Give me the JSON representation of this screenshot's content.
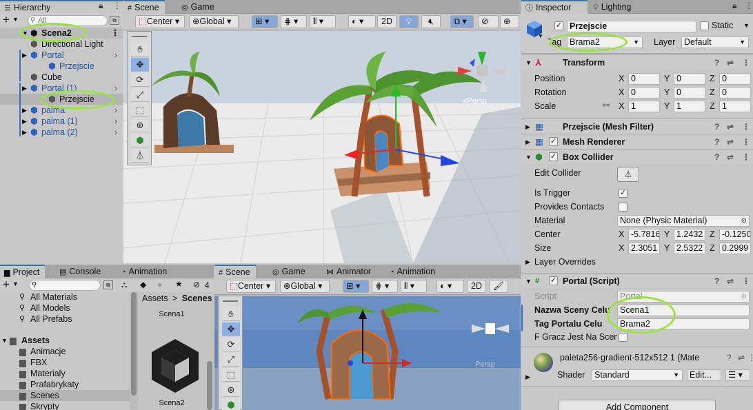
{
  "hierarchy": {
    "tab": "Hierarchy",
    "search_placeholder": "All",
    "scene": "Scena2",
    "items": [
      {
        "label": "Directional Light",
        "indent": 1,
        "kind": "obj"
      },
      {
        "label": "Portal",
        "indent": 1,
        "kind": "prefab"
      },
      {
        "label": "Przejscie",
        "indent": 2,
        "kind": "prefab-child"
      },
      {
        "label": "Cube",
        "indent": 1,
        "kind": "obj"
      },
      {
        "label": "Portal (1)",
        "indent": 1,
        "kind": "prefab"
      },
      {
        "label": "Przejscie",
        "indent": 2,
        "kind": "selected"
      },
      {
        "label": "palma",
        "indent": 1,
        "kind": "prefab"
      },
      {
        "label": "palma (1)",
        "indent": 1,
        "kind": "prefab"
      },
      {
        "label": "palma (2)",
        "indent": 1,
        "kind": "prefab"
      }
    ]
  },
  "top_view": {
    "tabs": {
      "scene": "Scene",
      "game": "Game"
    },
    "pivot": "Center",
    "space": "Global",
    "mode_2d": "2D",
    "gizmo_label": "<Persp"
  },
  "project": {
    "tabs": {
      "project": "Project",
      "console": "Console",
      "animation": "Animation"
    },
    "badge": "4",
    "favorites": [
      "All Materials",
      "All Models",
      "All Prefabs"
    ],
    "assets_root": "Assets",
    "folders": [
      "Animacje",
      "FBX",
      "Materialy",
      "Prafabrykaty",
      "Scenes",
      "Skrypty"
    ],
    "breadcrumb": {
      "root": "Assets",
      "sep": ">",
      "current": "Scenes"
    },
    "files": [
      "Scena1",
      "Scena2"
    ]
  },
  "bottom_view": {
    "tabs": {
      "scene": "Scene",
      "game": "Game",
      "animator": "Animator",
      "animation": "Animation"
    },
    "pivot": "Center",
    "space": "Global",
    "mode_2d": "2D",
    "gizmo_label": "Persp"
  },
  "inspector": {
    "tabs": {
      "inspector": "Inspector",
      "lighting": "Lighting"
    },
    "object_name": "Przejscie",
    "static_label": "Static",
    "tag_label": "Tag",
    "tag_value": "Brama2",
    "layer_label": "Layer",
    "layer_value": "Default",
    "transform": {
      "title": "Transform",
      "position": {
        "label": "Position",
        "x": "0",
        "y": "0",
        "z": "0"
      },
      "rotation": {
        "label": "Rotation",
        "x": "0",
        "y": "0",
        "z": "0"
      },
      "scale": {
        "label": "Scale",
        "x": "1",
        "y": "1",
        "z": "1"
      }
    },
    "mesh_filter": "Przejscie (Mesh Filter)",
    "mesh_renderer": "Mesh Renderer",
    "box_collider": {
      "title": "Box Collider",
      "edit_collider": "Edit Collider",
      "is_trigger": "Is Trigger",
      "provides_contacts": "Provides Contacts",
      "material_label": "Material",
      "material_value": "None (Physic Material)",
      "center": {
        "label": "Center",
        "x": "-5.7816",
        "y": "1.2432",
        "z": "-0.1250"
      },
      "size": {
        "label": "Size",
        "x": "2.3051",
        "y": "2.5322",
        "z": "0.2999"
      },
      "layer_overrides": "Layer Overrides"
    },
    "portal_script": {
      "title": "Portal (Script)",
      "script_label": "Script",
      "script_value": "Portal",
      "nazwa_label": "Nazwa Sceny Celu",
      "nazwa_value": "Scena1",
      "tag_label": "Tag Portalu Celu",
      "tag_value": "Brama2",
      "gracz_label": "F Gracz Jest Na Scen"
    },
    "material": {
      "name": "paleta256-gradient-512x512 1 (Mate",
      "shader_label": "Shader",
      "shader_value": "Standard",
      "edit_label": "Edit..."
    },
    "add_component": "Add Component"
  },
  "colors": {
    "accent": "#3a72b0",
    "highlight": "#9be33d",
    "selection": "#b4b4b4",
    "sky": "#c5d1dd",
    "ground": "#e9e9e9"
  }
}
